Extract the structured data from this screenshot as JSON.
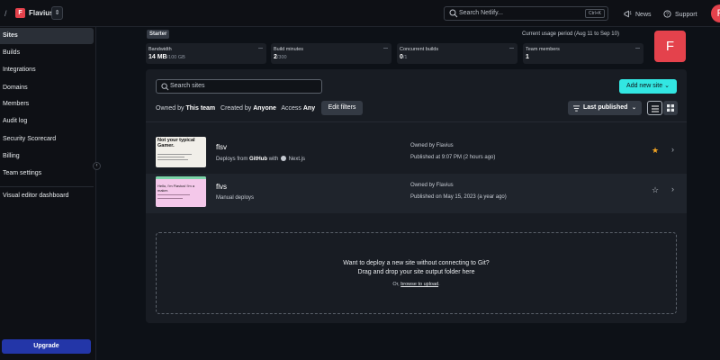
{
  "header": {
    "crumb_sep": "/",
    "team_initial": "F",
    "team_name": "Flavius",
    "switch_glyph": "⇕",
    "search_placeholder": "Search Netlify...",
    "search_shortcut": "Ctrl+K",
    "news_label": "News",
    "support_label": "Support",
    "user_initial": "F"
  },
  "sidebar": {
    "items": [
      {
        "label": "Sites",
        "active": true
      },
      {
        "label": "Builds"
      },
      {
        "label": "Integrations"
      },
      {
        "label": "Domains"
      },
      {
        "label": "Members"
      },
      {
        "label": "Audit log"
      },
      {
        "label": "Security Scorecard"
      },
      {
        "label": "Billing"
      },
      {
        "label": "Team settings"
      }
    ],
    "extra_item": "Visual editor dashboard",
    "collapse_glyph": "‹",
    "upgrade_label": "Upgrade"
  },
  "usage": {
    "plan": "Starter",
    "period": "Current usage period (Aug 11 to Sep 10)",
    "cards": [
      {
        "label": "Bandwidth",
        "value": "14 MB",
        "total": "/100 GB"
      },
      {
        "label": "Build minutes",
        "value": "2",
        "total": "/300"
      },
      {
        "label": "Concurrent builds",
        "value": "0",
        "total": "/1"
      },
      {
        "label": "Team members",
        "value": "1",
        "total": ""
      }
    ],
    "avatar_initial": "F"
  },
  "toolbar": {
    "search_placeholder": "Search sites",
    "add_site_label": "Add new site",
    "add_site_chevron": "⌄",
    "owned_by_label": "Owned by",
    "owned_by_value": "This team",
    "created_by_label": "Created by",
    "created_by_value": "Anyone",
    "access_label": "Access",
    "access_value": "Any",
    "edit_filters_label": "Edit filters",
    "sort_label": "Last published",
    "sort_chevron": "⌄"
  },
  "sites": [
    {
      "name": "flsv",
      "deploy_prefix": "Deploys from",
      "deploy_source": "GitHub",
      "deploy_with": "with",
      "framework": "Next.js",
      "owner": "Owned by Flavius",
      "published": "Published at 9:07 PM (2 hours ago)",
      "starred": true,
      "thumb_title": "Not your typical Gamer."
    },
    {
      "name": "flvs",
      "deploy_text": "Manual deploys",
      "owner": "Owned by Flavius",
      "published": "Published on May 15, 2023 (a year ago)",
      "starred": false,
      "thumb_title": "Hello, I'm Flavius! I'm a maker."
    }
  ],
  "icons": {
    "star_filled": "★",
    "star_empty": "☆",
    "chevron_right": "›"
  },
  "dropzone": {
    "line1": "Want to deploy a new site without connecting to Git?",
    "line2": "Drag and drop your site output folder here",
    "line3_prefix": "Or,",
    "line3_link": "browse to upload",
    "line3_suffix": "."
  },
  "colors": {
    "accent_teal": "#32e6e2",
    "brand_red": "#e4424c",
    "upgrade_blue": "#2336a8",
    "star_gold": "#f5a623"
  }
}
